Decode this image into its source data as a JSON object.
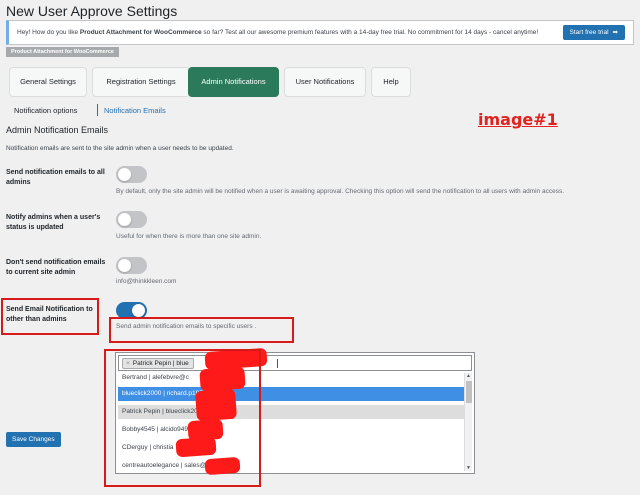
{
  "page": {
    "title": "New User Approve Settings"
  },
  "notice": {
    "text_prefix": "Hey! How do you like ",
    "text_bold": "Product Attachment for WooCommerce",
    "text_suffix": " so far? Test all our awesome premium features with a 14-day free trial. No commitment for 14 days - cancel anytime!",
    "trial_button": "Start free trial",
    "trial_arrow": "➡",
    "badge": "Product Attachment for WooCommerce"
  },
  "tabs": [
    {
      "label": "General Settings",
      "active": false
    },
    {
      "label": "Registration Settings",
      "active": false
    },
    {
      "label": "Admin Notifications",
      "active": true
    },
    {
      "label": "User Notifications",
      "active": false
    },
    {
      "label": "Help",
      "active": false
    }
  ],
  "subnav": {
    "options": "Notification options",
    "emails": "Notification Emails"
  },
  "annotation": {
    "label": "image#1"
  },
  "section": {
    "title": "Admin Notification Emails",
    "description": "Notification emails are sent to the site admin when a user needs to be updated."
  },
  "settings": [
    {
      "label": "Send notification emails to all admins",
      "description": "By default, only the site admin will be notified when a user is awaiting approval. Checking this option will send the notification to all users with admin access.",
      "enabled": false
    },
    {
      "label": "Notify admins when a user's status is updated",
      "description": "Useful for when there is more than one site admin.",
      "enabled": false
    },
    {
      "label": "Don't send notification emails to current site admin",
      "description": "info@thinkkleen.com",
      "enabled": false
    },
    {
      "label": "Send Email Notification to other than admins",
      "description": "Send admin notification emails to specific users .",
      "enabled": true
    }
  ],
  "user_select": {
    "chip_remove": "×",
    "chip_label": "Patrick Pepin | blue",
    "options": [
      {
        "label": "Bertrand | alefebvre@c",
        "state": "normal"
      },
      {
        "label": "blueclick2000 | richard.p197",
        "state": "highlight"
      },
      {
        "label": "Patrick Pepin | blueclick2004",
        "state": "selected"
      },
      {
        "label": "Bobby4545 | alcido949",
        "state": "normal"
      },
      {
        "label": "CDerguy | christia",
        "state": "normal"
      },
      {
        "label": "centreautoelegance | sales@",
        "state": "normal"
      }
    ],
    "scroll_up": "▲",
    "scroll_down": "▼"
  },
  "save_button": "Save Changes",
  "colors": {
    "active_tab": "#2c7a5c",
    "primary": "#2271b1",
    "annotation_red": "#d71a1a",
    "highlight_option": "#3f8fe4"
  }
}
